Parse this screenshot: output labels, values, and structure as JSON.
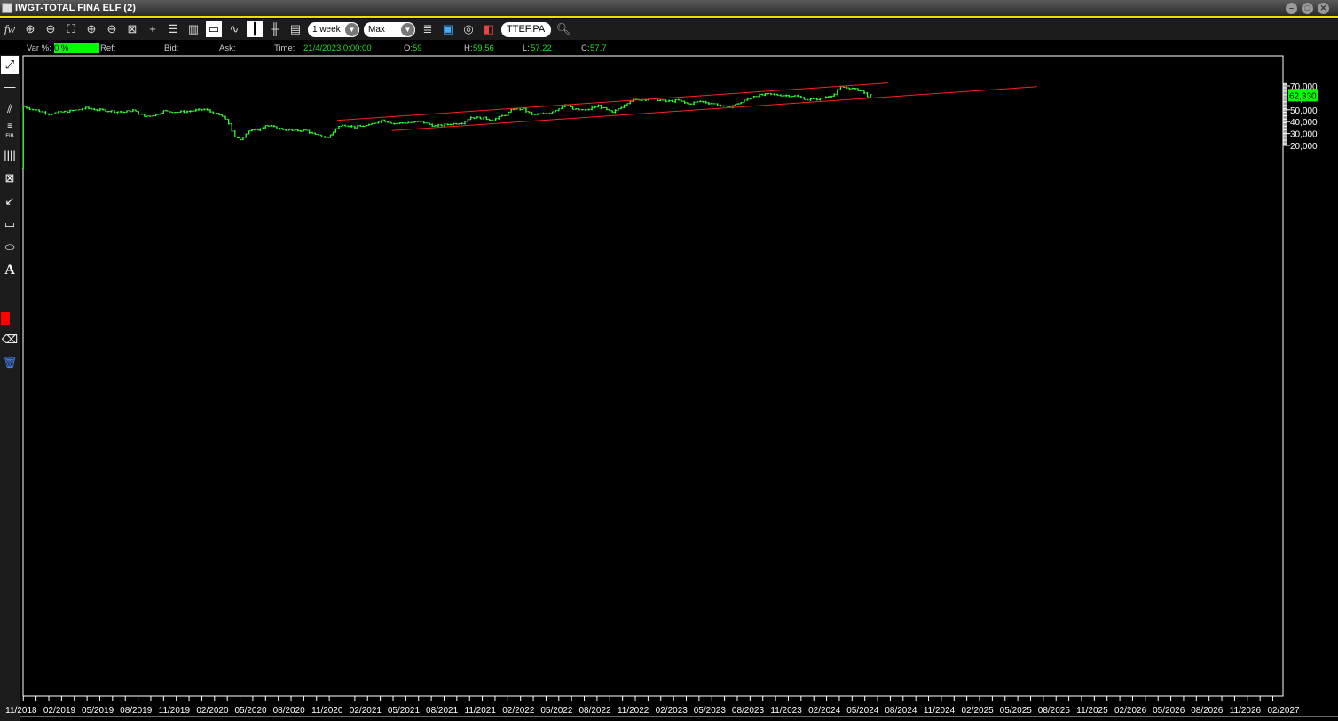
{
  "window": {
    "title": "IWGT-TOTAL FINA   ELF (2)",
    "buttons": [
      "minimize",
      "maximize",
      "close"
    ]
  },
  "toolbar": {
    "logo": "fw",
    "period": "1 week",
    "range": "Max",
    "symbol": "TTEF.PA",
    "icons": [
      "zoom-in-icon",
      "zoom-out-icon",
      "fit-icon",
      "zoom-in-vertical-icon",
      "zoom-out-vertical-icon",
      "reset-zoom-icon",
      "crosshair-icon",
      "list-icon",
      "grid-icon",
      "window-icon",
      "line-chart-icon",
      "candlestick-icon",
      "bar-chart-icon",
      "indicators-icon"
    ]
  },
  "info": {
    "var_label": "Var %:",
    "var_value": "0 %",
    "ref_label": "Ref:",
    "bid_label": "Bid:",
    "ask_label": "Ask:",
    "time_label": "Time:",
    "time_value": "21/4/2023 0:00:00",
    "open_label": "O:",
    "open_value": "59",
    "high_label": "H:",
    "high_value": "59,56",
    "low_label": "L:",
    "low_value": "57,22",
    "close_label": "C:",
    "close_value": "57,7"
  },
  "drawing_tools": [
    "select",
    "horizontal-line",
    "trend-channel",
    "fibonacci",
    "vertical-lines",
    "gann-fan",
    "speed-lines",
    "rectangle",
    "ellipse",
    "text",
    "line-width",
    "color",
    "eraser",
    "delete"
  ],
  "fib_label": "FIB",
  "text_tool_label": "A",
  "colors": {
    "price": "#33ff33",
    "channel": "#ff2020",
    "last_price_bg": "#00ff00",
    "accent": "#e8e000"
  },
  "chart_data": {
    "type": "bar",
    "title": "IWGT-TOTAL FINA ELF",
    "x_unit": "months from 02/2019",
    "ylim": [
      19000,
      72500
    ],
    "y_ticks": [
      "20,000",
      "30,000",
      "40,000",
      "50,000",
      "60,000",
      "70,000"
    ],
    "y_tick_values": [
      20000,
      30000,
      40000,
      50000,
      60000,
      70000
    ],
    "x_ticks": [
      "11/2018",
      "02/2019",
      "05/2019",
      "08/2019",
      "11/2019",
      "02/2020",
      "05/2020",
      "08/2020",
      "11/2020",
      "02/2021",
      "05/2021",
      "08/2021",
      "11/2021",
      "02/2022",
      "05/2022",
      "08/2022",
      "11/2022",
      "02/2023",
      "05/2023",
      "08/2023",
      "11/2023",
      "02/2024",
      "05/2024",
      "08/2024",
      "11/2024",
      "02/2025",
      "05/2025",
      "08/2025",
      "11/2025",
      "02/2026",
      "05/2026",
      "08/2026",
      "11/2026",
      "02/2027"
    ],
    "last_price": "62,330",
    "last_price_value": 62330,
    "series": [
      {
        "name": "TTEF.PA weekly",
        "points": [
          [
            -2,
            52.6
          ],
          [
            -1,
            49.6
          ],
          [
            0,
            46.6
          ],
          [
            1,
            48.1
          ],
          [
            2.1,
            49.6
          ],
          [
            2.9,
            51.5
          ],
          [
            3.8,
            50.0
          ],
          [
            4.9,
            48.9
          ],
          [
            5.9,
            48.1
          ],
          [
            6.6,
            49.6
          ],
          [
            7.5,
            44.4
          ],
          [
            8.4,
            45.9
          ],
          [
            9.0,
            48.9
          ],
          [
            10.1,
            48.1
          ],
          [
            11.1,
            48.9
          ],
          [
            12.2,
            50.4
          ],
          [
            12.9,
            47.4
          ],
          [
            13.6,
            44.4
          ],
          [
            14.1,
            38.4
          ],
          [
            14.6,
            26.5
          ],
          [
            15.0,
            25.0
          ],
          [
            15.7,
            32.5
          ],
          [
            16.4,
            33.2
          ],
          [
            17.0,
            36.9
          ],
          [
            18.1,
            34.0
          ],
          [
            19.1,
            32.5
          ],
          [
            20.2,
            32.5
          ],
          [
            20.9,
            28.7
          ],
          [
            21.9,
            26.5
          ],
          [
            22.5,
            34.0
          ],
          [
            23.0,
            37.7
          ],
          [
            24.0,
            35.4
          ],
          [
            25.1,
            36.9
          ],
          [
            26.1,
            41.4
          ],
          [
            27.1,
            38.4
          ],
          [
            28.2,
            39.2
          ],
          [
            29.2,
            39.9
          ],
          [
            30.3,
            36.2
          ],
          [
            31.3,
            37.7
          ],
          [
            32.4,
            39.2
          ],
          [
            33.1,
            43.7
          ],
          [
            34.1,
            43.0
          ],
          [
            34.8,
            41.4
          ],
          [
            35.8,
            45.9
          ],
          [
            36.5,
            51.1
          ],
          [
            37.2,
            50.4
          ],
          [
            37.9,
            45.9
          ],
          [
            39.0,
            46.6
          ],
          [
            40.0,
            51.1
          ],
          [
            40.5,
            54.9
          ],
          [
            41.1,
            50.4
          ],
          [
            42.1,
            49.6
          ],
          [
            43.1,
            53.4
          ],
          [
            44.2,
            47.4
          ],
          [
            44.9,
            52.6
          ],
          [
            45.6,
            57.8
          ],
          [
            46.3,
            58.6
          ],
          [
            47.3,
            59.3
          ],
          [
            48.4,
            57.1
          ],
          [
            49.4,
            57.8
          ],
          [
            50.1,
            54.9
          ],
          [
            51.1,
            57.1
          ],
          [
            52.2,
            54.9
          ],
          [
            53.2,
            51.9
          ],
          [
            54.3,
            56.3
          ],
          [
            55.3,
            61.6
          ],
          [
            56.4,
            63.1
          ],
          [
            57.4,
            62.3
          ],
          [
            58.5,
            61.6
          ],
          [
            59.5,
            58.6
          ],
          [
            60.5,
            59.3
          ],
          [
            61.6,
            63.1
          ],
          [
            62.1,
            69.0
          ],
          [
            62.8,
            68.3
          ],
          [
            63.7,
            66.0
          ],
          [
            64.2,
            61.6
          ],
          [
            64.7,
            62.3
          ]
        ]
      }
    ],
    "channel_lines": [
      {
        "name": "upper",
        "from": [
          22.6,
          41.1
        ],
        "to": [
          65.8,
          72.5
        ]
      },
      {
        "name": "lower",
        "from": [
          26.9,
          32.5
        ],
        "to": [
          77.5,
          69.4
        ]
      }
    ]
  }
}
